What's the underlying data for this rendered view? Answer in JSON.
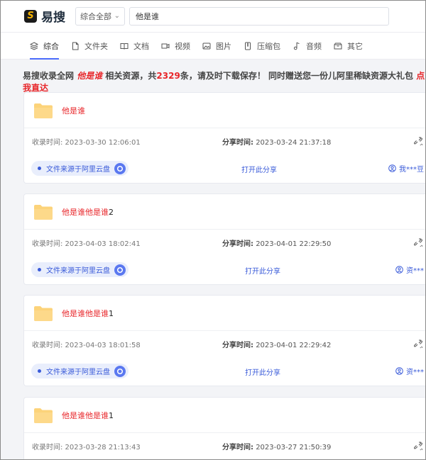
{
  "header": {
    "logo_mark": "S",
    "logo_text": "易搜",
    "category_select": "综合全部",
    "search_value": "他是谁"
  },
  "tabs": [
    {
      "label": "综合",
      "icon": "layers-icon"
    },
    {
      "label": "文件夹",
      "icon": "file-icon"
    },
    {
      "label": "文档",
      "icon": "book-icon"
    },
    {
      "label": "视频",
      "icon": "video-icon"
    },
    {
      "label": "图片",
      "icon": "image-icon"
    },
    {
      "label": "压缩包",
      "icon": "archive-icon"
    },
    {
      "label": "音频",
      "icon": "music-icon"
    },
    {
      "label": "其它",
      "icon": "box-icon"
    }
  ],
  "notice": {
    "prefix": "易搜收录全网",
    "keyword": "他是谁",
    "mid1": "相关资源，共",
    "count": "2329",
    "mid2": "条，请及时下载保存！ 同时赠送您一份儿阿里稀缺资源大礼包",
    "link": "点我直达"
  },
  "results": [
    {
      "title_red": "他是谁",
      "title_dark": "",
      "collected": "收录时间: 2023-03-30 12:06:01",
      "shared_label": "分享时间:",
      "shared_value": "2023-03-24 21:37:18",
      "source": "文件来源于阿里云盘",
      "open": "打开此分享",
      "user": "我***豆"
    },
    {
      "title_red": "他是谁他是谁",
      "title_dark": "2",
      "collected": "收录时间: 2023-04-03 18:02:41",
      "shared_label": "分享时间:",
      "shared_value": "2023-04-01 22:29:50",
      "source": "文件来源于阿里云盘",
      "open": "打开此分享",
      "user": "资***"
    },
    {
      "title_red": "他是谁他是谁",
      "title_dark": "1",
      "collected": "收录时间: 2023-04-03 18:01:58",
      "shared_label": "分享时间:",
      "shared_value": "2023-04-01 22:29:42",
      "source": "文件来源于阿里云盘",
      "open": "打开此分享",
      "user": "资***"
    },
    {
      "title_red": "他是谁他是谁",
      "title_dark": "1",
      "collected": "收录时间: 2023-03-28 21:13:43",
      "shared_label": "分享时间:",
      "shared_value": "2023-03-27 21:50:39",
      "source": "",
      "open": "",
      "user": ""
    }
  ],
  "colors": {
    "accent": "#3a5bd9",
    "highlight": "#e8262a",
    "folder": "#fcd37a"
  }
}
